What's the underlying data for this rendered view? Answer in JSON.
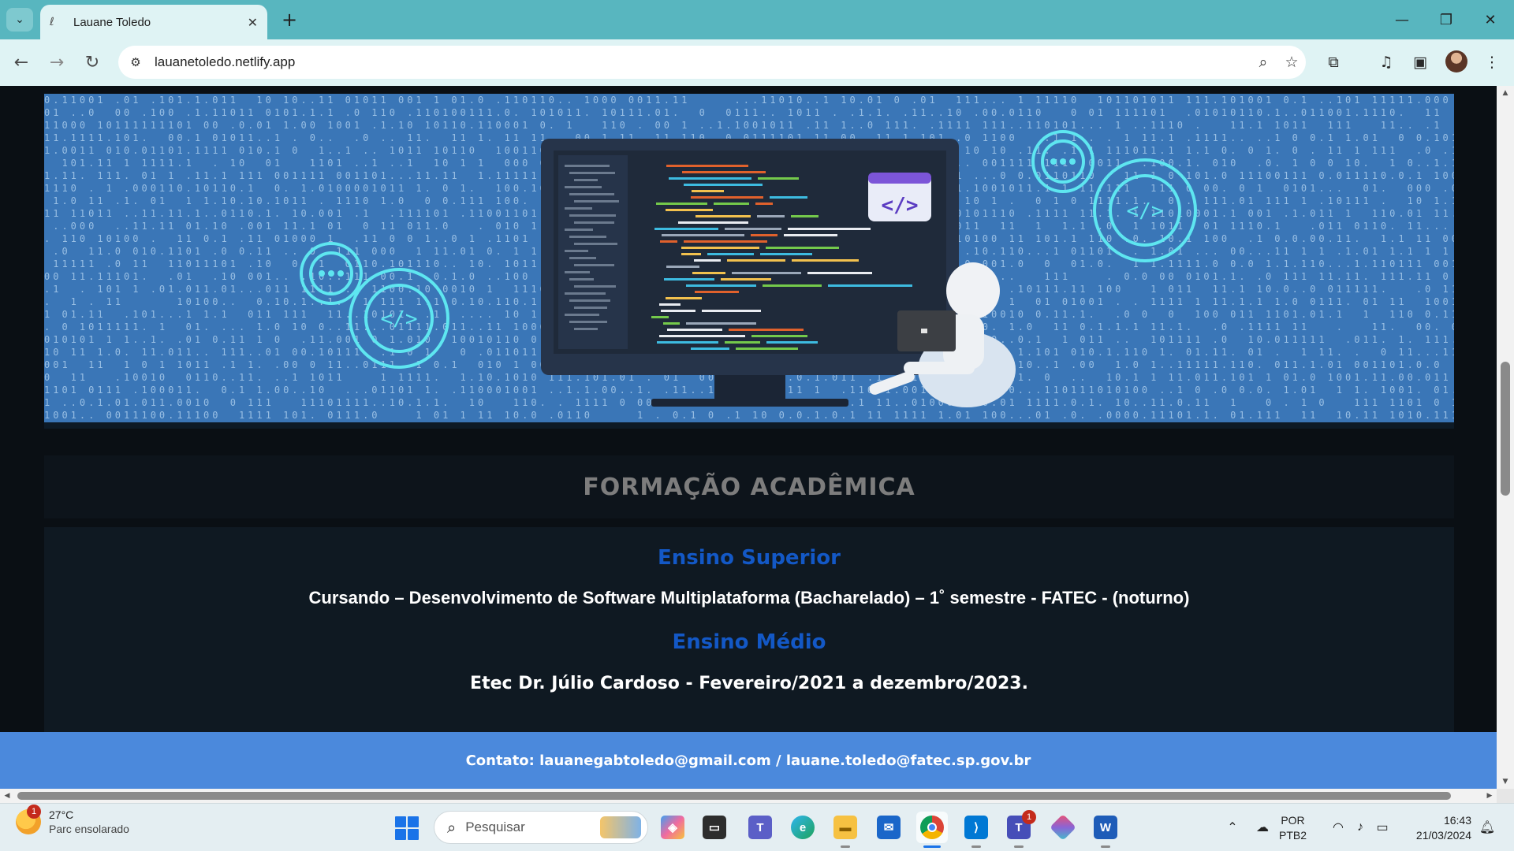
{
  "browser": {
    "tab_title": "Lauane Toledo",
    "url": "lauanetoledo.netlify.app"
  },
  "page": {
    "section_title": "FORMAÇÃO ACADÊMICA",
    "higher_ed_heading": "Ensino Superior",
    "higher_ed_text": "Cursando – Desenvolvimento de Software Multiplataforma (Bacharelado) – 1˚ semestre - FATEC - (noturno)",
    "high_school_heading": "Ensino Médio",
    "high_school_text": "Etec Dr. Júlio Cardoso - Fevereiro/2021 a dezembro/2023.",
    "contact": "Contato: lauanegabtoledo@gmail.com / lauane.toledo@fatec.sp.gov.br",
    "banner_code_tag": "</>"
  },
  "taskbar": {
    "weather_badge": "1",
    "weather_temp": "27°C",
    "weather_condition": "Parc ensolarado",
    "search_placeholder": "Pesquisar",
    "teams_badge": "1",
    "lang_line1": "POR",
    "lang_line2": "PTB2",
    "time": "16:43",
    "date": "21/03/2024"
  },
  "colors": {
    "tabstrip": "#58b6bf",
    "toolbar": "#dff3f4",
    "banner": "#3a76b7",
    "heading_blue": "#1358c6",
    "contact_bar": "#4b89dc",
    "page_bg": "#0a0f14"
  }
}
